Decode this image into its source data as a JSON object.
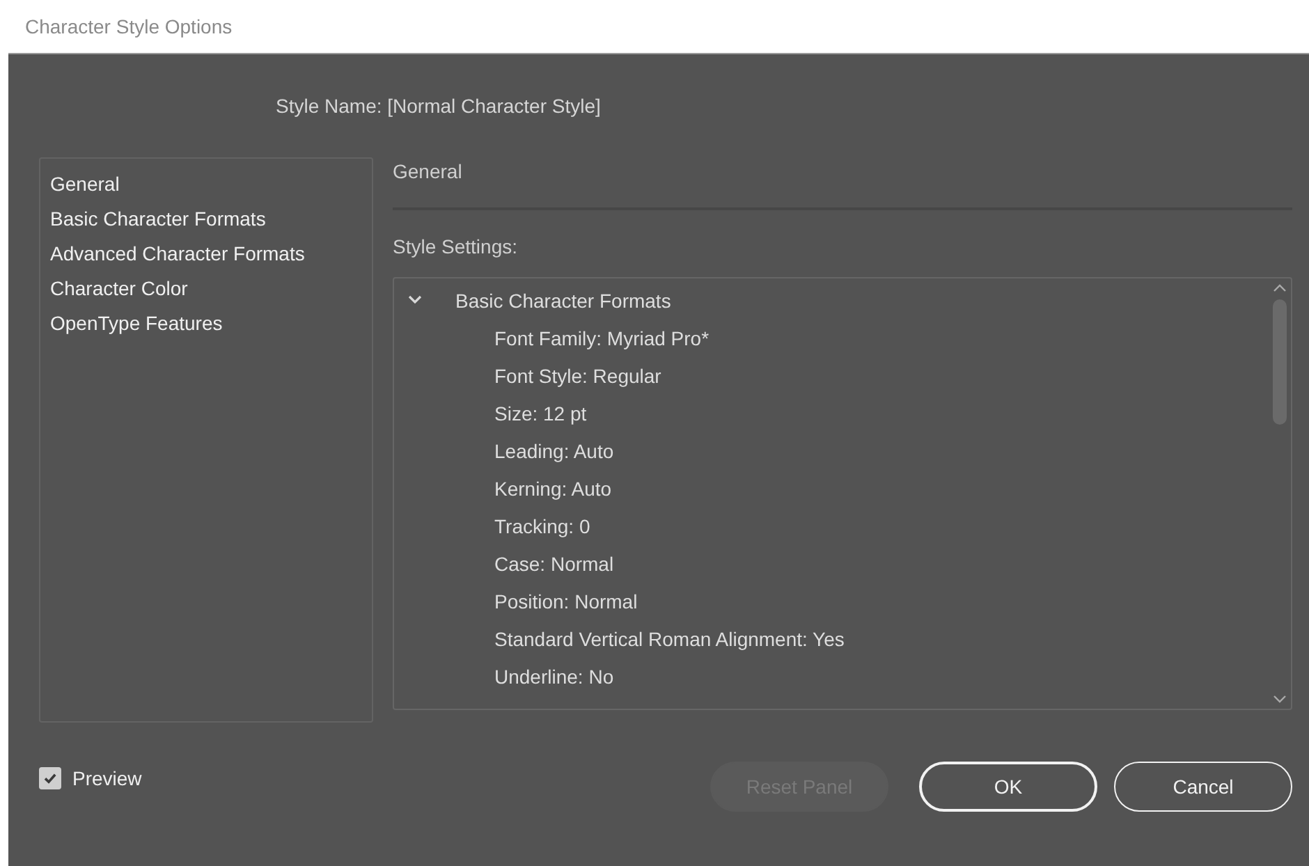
{
  "window": {
    "title": "Character Style Options"
  },
  "style_name": "Style Name: [Normal Character Style]",
  "sidebar": {
    "items": [
      {
        "label": "General",
        "selected": false
      },
      {
        "label": "Basic Character Formats",
        "selected": false
      },
      {
        "label": "Advanced Character Formats",
        "selected": false
      },
      {
        "label": "Character Color",
        "selected": false
      },
      {
        "label": "OpenType Features",
        "selected": false
      }
    ]
  },
  "section_title": "General",
  "settings_label": "Style Settings:",
  "settings_tree": [
    {
      "label": "Basic Character Formats",
      "expanded": true,
      "children": [
        {
          "label": "Font Family: Myriad Pro*"
        },
        {
          "label": "Font Style: Regular"
        },
        {
          "label": "Size: 12 pt"
        },
        {
          "label": "Leading: Auto"
        },
        {
          "label": "Kerning: Auto"
        },
        {
          "label": "Tracking: 0"
        },
        {
          "label": "Case: Normal"
        },
        {
          "label": "Position: Normal"
        },
        {
          "label": "Standard Vertical Roman Alignment: Yes"
        },
        {
          "label": "Underline: No"
        }
      ]
    }
  ],
  "preview": {
    "label": "Preview",
    "checked": true
  },
  "buttons": [
    {
      "label": "Reset Panel",
      "kind": "secondary",
      "disabled": true
    },
    {
      "label": "OK",
      "kind": "primary",
      "disabled": false
    },
    {
      "label": "Cancel",
      "kind": "secondary",
      "disabled": false
    }
  ]
}
